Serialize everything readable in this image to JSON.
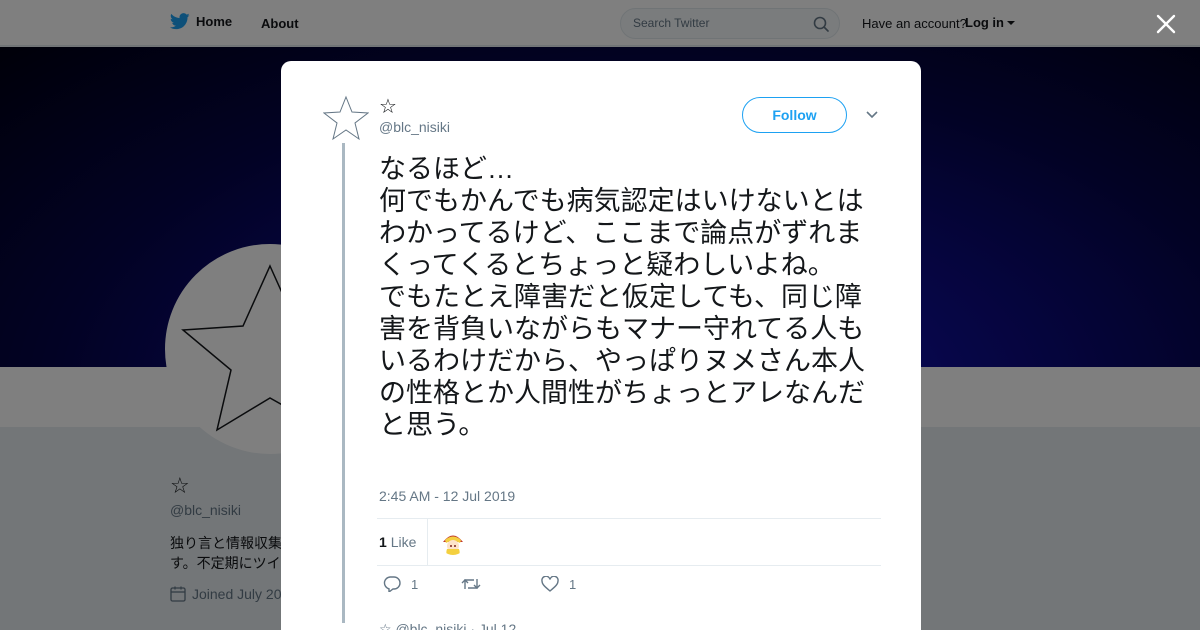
{
  "topbar": {
    "home_label": "Home",
    "about_label": "About",
    "search_placeholder": "Search Twitter",
    "account_prompt": "Have an account?",
    "login_label": "Log in"
  },
  "profile": {
    "name": "☆",
    "handle": "@blc_nisiki",
    "bio": "独り言と情報収集\nす。不定期にツイ",
    "joined": "Joined July 20"
  },
  "tweet": {
    "author_name": "☆",
    "author_handle": "@blc_nisiki",
    "follow_label": "Follow",
    "text": "なるほど…\n何でもかんでも病気認定はいけないとはわかってるけど、ここまで論点がずれまくってくるとちょっと疑わしいよね。\nでもたとえ障害だと仮定しても、同じ障害を背負いながらもマナー守れてる人もいるわけだから、やっぱりヌメさん本人の性格とか人間性がちょっとアレなんだと思う。",
    "timestamp": "2:45 AM - 12 Jul 2019",
    "likes_count": "1",
    "likes_label": "Like",
    "reply_count": "1",
    "retweet_count": "",
    "like_action_count": "1"
  },
  "next_tweet": {
    "preview": "☆ @blc_nisiki · Jul 12"
  },
  "colors": {
    "accent": "#1da1f2",
    "text": "#14171a",
    "muted": "#657786"
  }
}
